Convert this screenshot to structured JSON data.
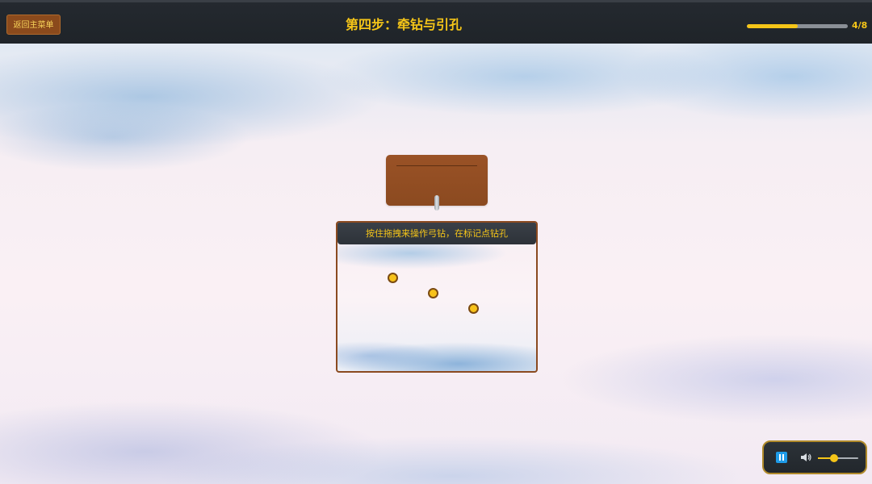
{
  "header": {
    "back_label": "返回主菜单",
    "title": "第四步：牵钻与引孔",
    "progress_text": "4/8",
    "progress_value": 0.5
  },
  "workspace": {
    "instruction": "按住拖拽来操作弓钻，在标记点钻孔",
    "markers": [
      {
        "label": "drill-point-1"
      },
      {
        "label": "drill-point-2"
      },
      {
        "label": "drill-point-3"
      }
    ]
  },
  "audio": {
    "pause_icon": "pause-icon",
    "volume_icon": "speaker-icon",
    "volume_level": 0.4,
    "accent_color": "#f5c518",
    "button_color": "#1e9be8"
  },
  "colors": {
    "wood": "#8b4a20",
    "accent": "#f5c518",
    "bar": "#24292f"
  }
}
